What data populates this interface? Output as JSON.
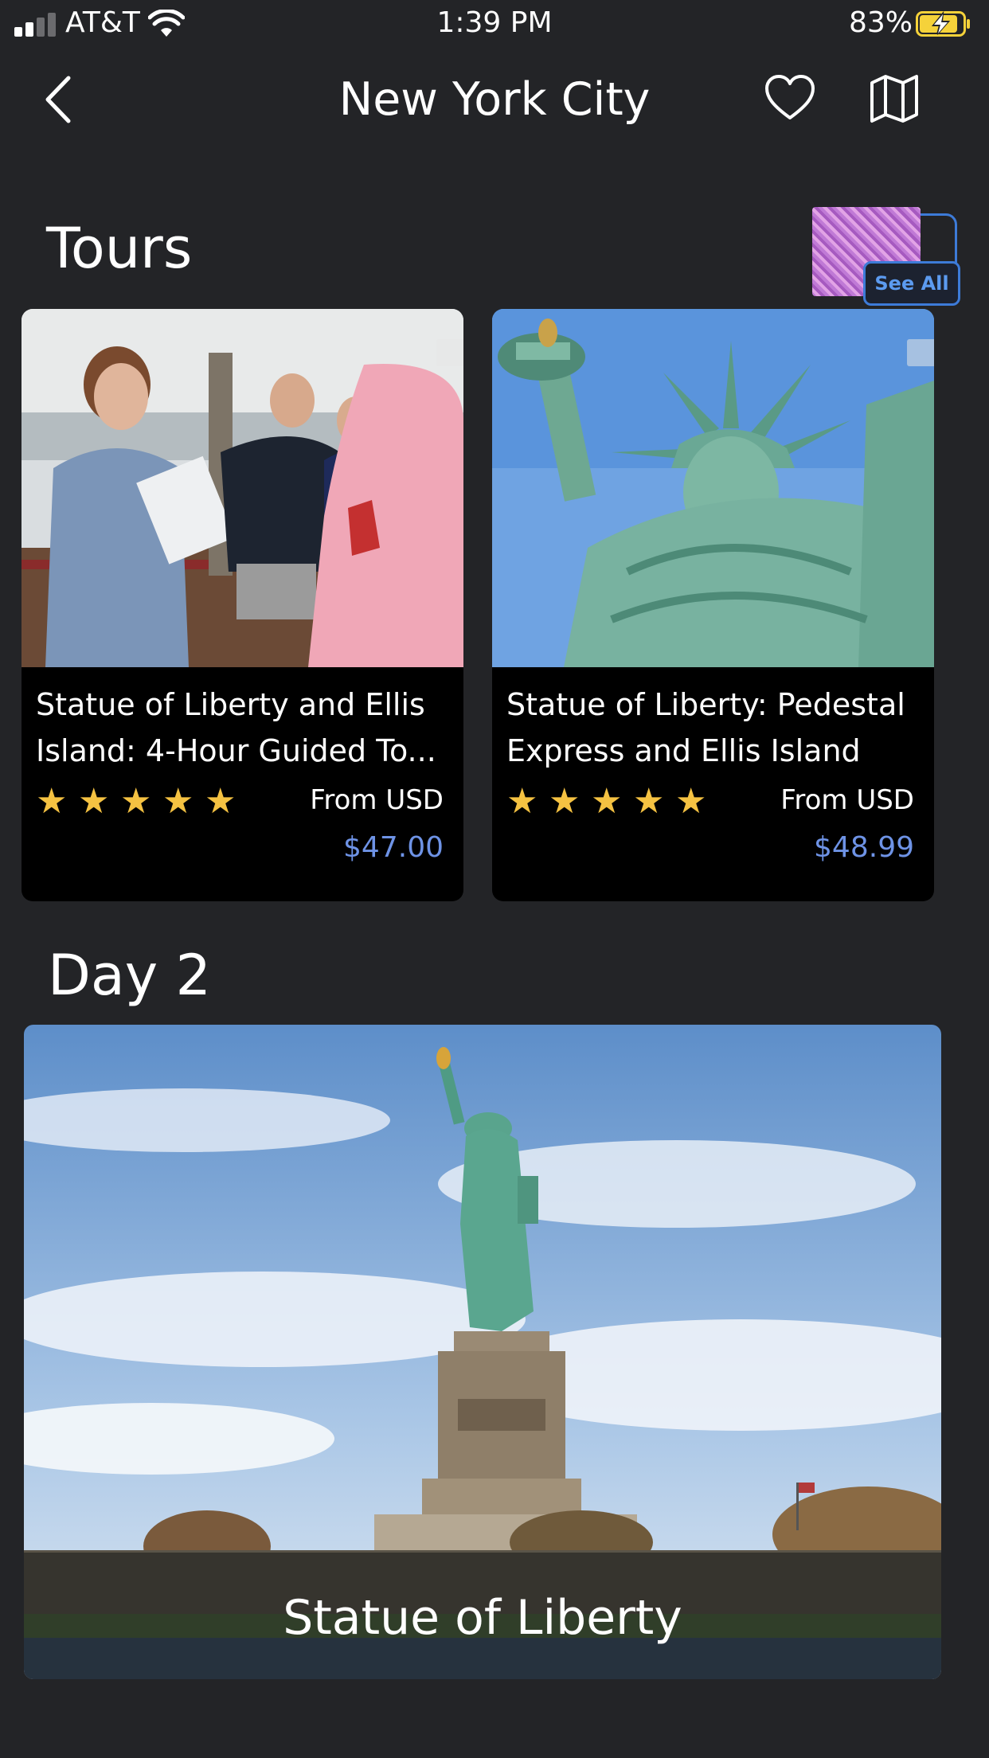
{
  "status_bar": {
    "carrier": "AT&T",
    "time": "1:39 PM",
    "battery_percent": "83%",
    "battery_level": 0.83,
    "charging": true,
    "signal_bars": 2
  },
  "nav": {
    "title": "New York City",
    "back_icon": "chevron-left-icon",
    "favorite_icon": "heart-icon",
    "map_icon": "map-icon"
  },
  "tours": {
    "title": "Tours",
    "see_all_label": "See All",
    "items": [
      {
        "title": "Statue of Liberty and Ellis Island: 4-Hour Guided To...",
        "rating": 5,
        "from_label": "From USD",
        "price": "$47.00"
      },
      {
        "title": "Statue of Liberty: Pedestal Express and Ellis Island",
        "rating": 5,
        "from_label": "From USD",
        "price": "$48.99"
      }
    ]
  },
  "day": {
    "title": "Day 2",
    "place": {
      "name": "Statue of Liberty"
    }
  },
  "colors": {
    "background": "#232427",
    "card": "#000000",
    "price": "#6e93e6",
    "star": "#f5c242",
    "accent": "#3d7bd8"
  }
}
